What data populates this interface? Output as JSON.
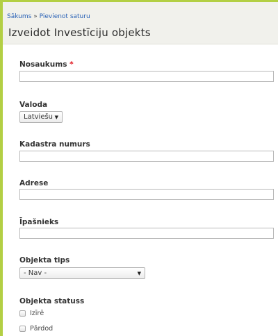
{
  "breadcrumb": {
    "home": "Sākums",
    "separator": "»",
    "current": "Pievienot saturu"
  },
  "page_title": "Izveidot Investīciju objekts",
  "form": {
    "nosaukums": {
      "label": "Nosaukums",
      "required_mark": "*",
      "value": ""
    },
    "valoda": {
      "label": "Valoda",
      "selected": "Latviešu"
    },
    "kadastra_numurs": {
      "label": "Kadastra numurs",
      "value": ""
    },
    "adrese": {
      "label": "Adrese",
      "value": ""
    },
    "ipasnieks": {
      "label": "Īpašnieks",
      "value": ""
    },
    "objekta_tips": {
      "label": "Objekta tips",
      "selected": "- Nav -"
    },
    "objekta_statuss": {
      "label": "Objekta statuss",
      "options": [
        "Izīrē",
        "Pārdod"
      ]
    }
  },
  "colors": {
    "frame_accent": "#b3cf44",
    "link": "#2a62b6",
    "required": "#e0141e"
  },
  "icons": {
    "select_arrow": "chevron-down-icon"
  }
}
